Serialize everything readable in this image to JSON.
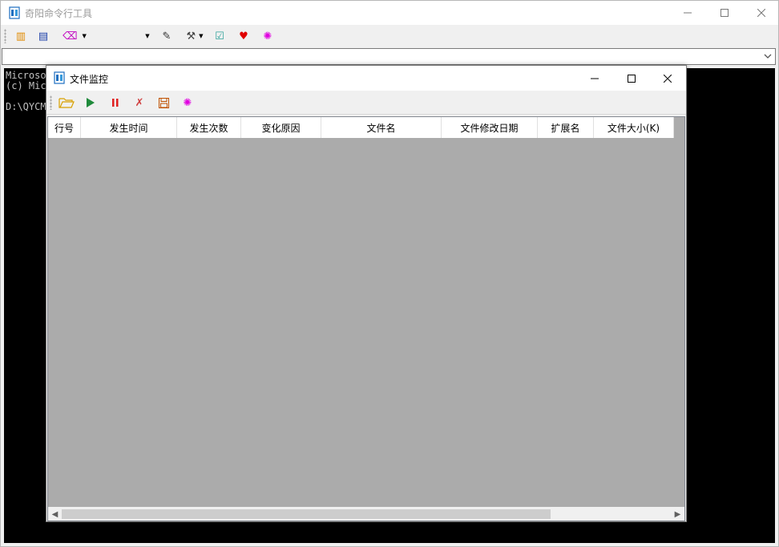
{
  "app": {
    "title": "奇阳命令行工具"
  },
  "toolbar": {
    "items": [
      {
        "icon": "copy-icon",
        "glyph": "🗐",
        "color": "#e08a00"
      },
      {
        "icon": "book-icon",
        "glyph": "▤",
        "color": "#1b3ea8"
      },
      {
        "icon": "eraser-icon",
        "glyph": "⌫",
        "color": "#c000c0"
      },
      {
        "icon": "wand-icon",
        "glyph": "✎",
        "color": "#333333"
      },
      {
        "icon": "tools-icon",
        "glyph": "🛠",
        "color": "#444444"
      },
      {
        "icon": "checkbox-icon",
        "glyph": "☑",
        "color": "#2aa198"
      },
      {
        "icon": "heart-icon",
        "glyph": "♥",
        "color": "#e00000"
      },
      {
        "icon": "gear-icon",
        "glyph": "✺",
        "color": "#e000e0"
      }
    ]
  },
  "command_input": {
    "value": ""
  },
  "console": {
    "lines": [
      "Microso",
      "(c) Mic",
      "",
      "D:\\QYCM"
    ]
  },
  "file_monitor": {
    "title": "文件监控",
    "toolbar": [
      {
        "icon": "open-folder-icon",
        "glyph": "🗁",
        "color": "#d8a000"
      },
      {
        "icon": "play-icon",
        "glyph": "▶",
        "color": "#1f8a3b"
      },
      {
        "icon": "pause-icon",
        "glyph": "❚❚",
        "color": "#e02020"
      },
      {
        "icon": "delete-icon",
        "glyph": "✗",
        "color": "#d04040"
      },
      {
        "icon": "save-icon",
        "glyph": "🖫",
        "color": "#c05000"
      },
      {
        "icon": "settings-icon",
        "glyph": "✺",
        "color": "#e000e0"
      }
    ],
    "columns": [
      "行号",
      "发生时间",
      "发生次数",
      "变化原因",
      "文件名",
      "文件修改日期",
      "扩展名",
      "文件大小(K)"
    ],
    "rows": []
  }
}
